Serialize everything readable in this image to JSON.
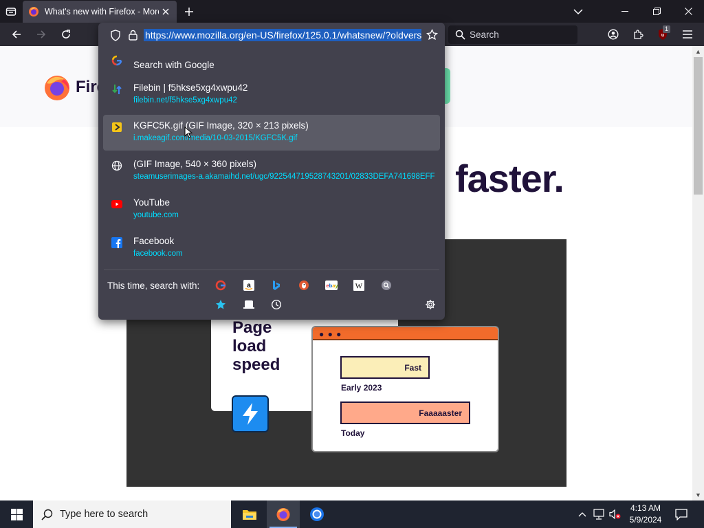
{
  "tab": {
    "title": "What's new with Firefox - More"
  },
  "urlbar": {
    "url": "https://www.mozilla.org/en-US/firefox/125.0.1/whatsnew/?oldvers"
  },
  "searchbar": {
    "placeholder": "Search"
  },
  "extensions": {
    "ublock_badge": "1"
  },
  "results": [
    {
      "icon": "google-icon",
      "title": "Search with Google",
      "url": ""
    },
    {
      "icon": "filebin-icon",
      "title": "Filebin | f5hkse5xg4xwpu42",
      "url": "filebin.net/f5hkse5xg4xwpu42"
    },
    {
      "icon": "gif-file-icon",
      "title": "KGFC5K.gif (GIF Image, 320 × 213 pixels)",
      "url": "i.makeagif.com/media/10-03-2015/KGFC5K.gif",
      "selected": true
    },
    {
      "icon": "globe-icon",
      "title": "(GIF Image, 540 × 360 pixels)",
      "url": "steamuserimages-a.akamaihd.net/ugc/922544719528743201/02833DEFA741698EFF..."
    },
    {
      "icon": "youtube-icon",
      "title": "YouTube",
      "url": "youtube.com"
    },
    {
      "icon": "facebook-icon",
      "title": "Facebook",
      "url": "facebook.com"
    }
  ],
  "oneoff": {
    "label": "This time, search with:"
  },
  "page": {
    "wordmark": "Firef",
    "headline": "faster.",
    "card_text": "Page load speed",
    "fast_label": "Fast",
    "early_label": "Early 2023",
    "faster_label": "Faaaaaster",
    "today_label": "Today"
  },
  "taskbar": {
    "search_placeholder": "Type here to search",
    "time": "4:13 AM",
    "date": "5/9/2024"
  },
  "colors": {
    "accent_url": "#00ddff",
    "selection": "#1e5fbf",
    "popup_bg": "#42414d"
  }
}
